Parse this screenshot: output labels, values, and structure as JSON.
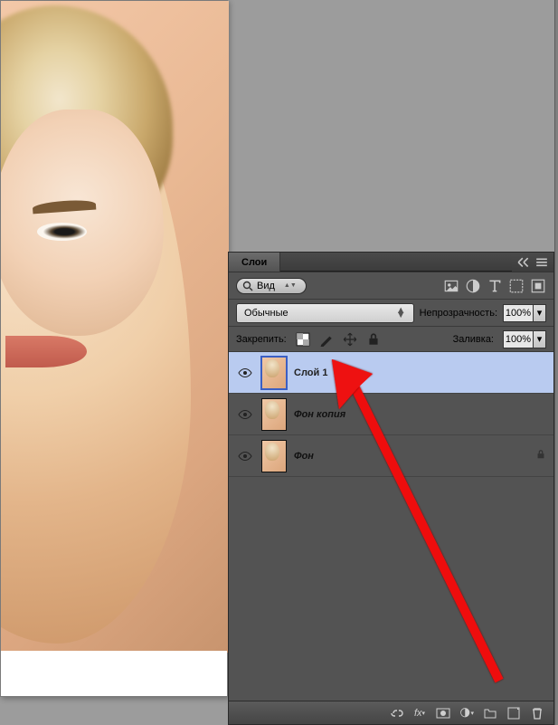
{
  "panel": {
    "title": "Слои",
    "filter_button": "Вид",
    "blend_mode": "Обычные",
    "opacity_label": "Непрозрачность:",
    "opacity_value": "100%",
    "lock_label": "Закрепить:",
    "fill_label": "Заливка:",
    "fill_value": "100%"
  },
  "layers": [
    {
      "name": "Слой 1",
      "visible": true,
      "selected": true,
      "locked": false
    },
    {
      "name": "Фон копия",
      "visible": true,
      "selected": false,
      "locked": false
    },
    {
      "name": "Фон",
      "visible": true,
      "selected": false,
      "locked": true
    }
  ]
}
